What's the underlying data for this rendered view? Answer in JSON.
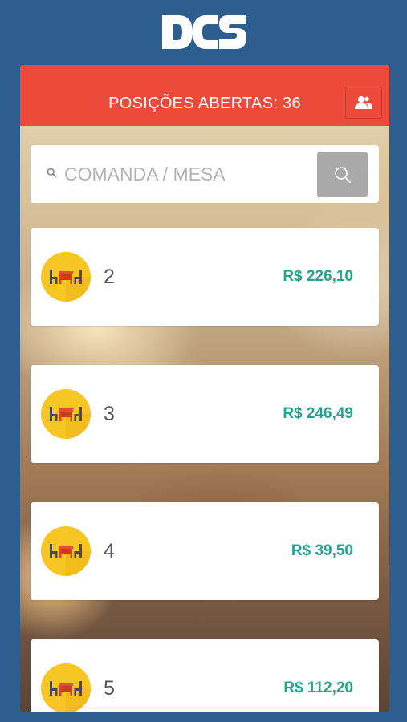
{
  "app": {
    "logo_text": "DCS"
  },
  "header": {
    "title": "POSIÇÕES ABERTAS: 36",
    "users_icon": "users-icon"
  },
  "search": {
    "placeholder": "COMANDA / MESA",
    "value": "",
    "button_icon": "search-icon"
  },
  "colors": {
    "background": "#2e5e8e",
    "header": "#ee4a3c",
    "price": "#21a58f",
    "icon_circle": "#f7c524",
    "search_button": "#a9a9a9"
  },
  "positions": [
    {
      "number": "2",
      "amount": "R$ 226,10",
      "icon": "table-chairs-icon"
    },
    {
      "number": "3",
      "amount": "R$ 246,49",
      "icon": "table-chairs-icon"
    },
    {
      "number": "4",
      "amount": "R$ 39,50",
      "icon": "table-chairs-icon"
    },
    {
      "number": "5",
      "amount": "R$ 112,20",
      "icon": "table-chairs-icon"
    }
  ]
}
